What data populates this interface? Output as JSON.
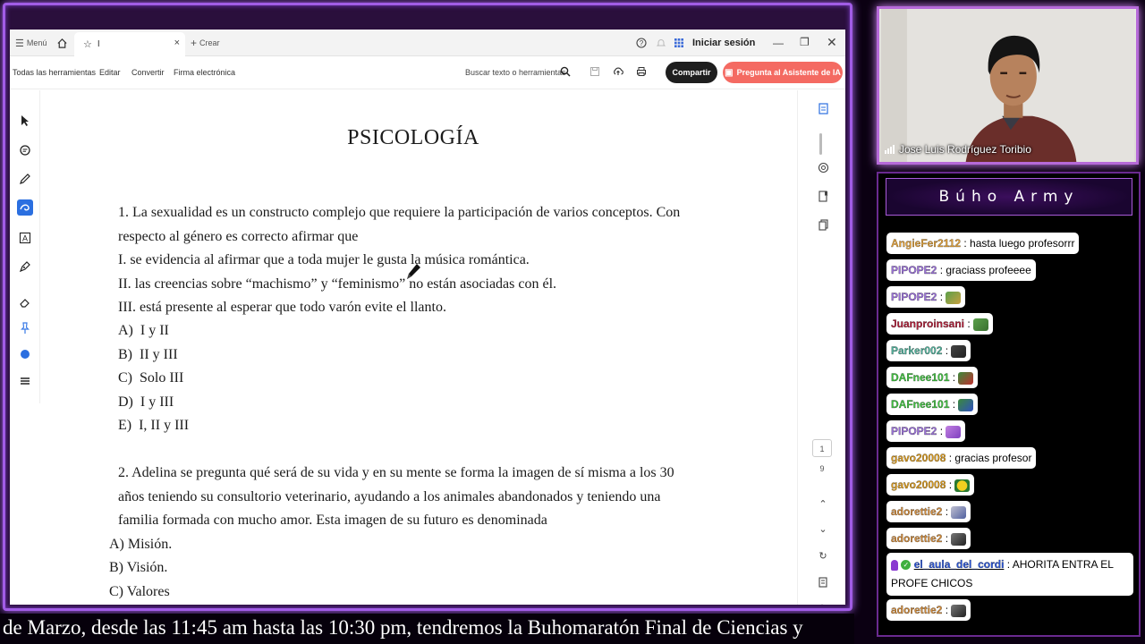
{
  "browser": {
    "menu_label": "Menú",
    "tab_title": "I",
    "new_tab_label": "Crear",
    "sign_in": "Iniciar sesión"
  },
  "toolbar": {
    "all_tools": "Todas las herramientas",
    "edit": "Editar",
    "convert": "Convertir",
    "esign": "Firma electrónica",
    "search_placeholder": "Buscar texto o herramientas",
    "share": "Compartir",
    "ai_assistant": "Pregunta al Asistente de IA"
  },
  "document": {
    "title": "PSICOLOGÍA",
    "q1": {
      "stem_line1": "1. La sexualidad es un constructo complejo que requiere la participación de varios conceptos. Con",
      "stem_line2": "respecto al género es correcto afirmar que",
      "statements": [
        "I. se evidencia al afirmar que a toda mujer le gusta la música romántica.",
        "II. las creencias sobre “machismo” y “feminismo” no están asociadas con él.",
        "III. está presente al esperar que todo varón evite el llanto."
      ],
      "options": [
        "A)  I y II",
        "B)  II y III",
        "C)  Solo III",
        "D)  I y III",
        "E)  I, II y III"
      ]
    },
    "q2": {
      "stem_line1": "2. Adelina se pregunta qué será de su vida y en su mente se forma la imagen de sí misma a los 30",
      "stem_line2": "años teniendo su consultorio veterinario, ayudando a los animales abandonados y teniendo una",
      "stem_line3": "familia formada con mucho amor. Esta imagen de su futuro es denominada",
      "options": [
        "A) Misión.",
        "B) Visión.",
        "C) Valores"
      ]
    }
  },
  "pager": {
    "current": "1",
    "total": "9"
  },
  "ticker_text": "de Marzo, desde las 11:45 am hasta las 10:30 pm, tendremos la Buhomaratón Final de Ciencias y",
  "webcam": {
    "name": "Jose Luis Rodríguez Toribio"
  },
  "chat": {
    "title": "Búho Army",
    "messages": [
      {
        "user": "AngieFer2112",
        "text": ": hasta luego profesorrr",
        "color": "#e0a03a"
      },
      {
        "user": "PIPOPE2",
        "text": ": graciass profeeee",
        "color": "#9a70d8"
      },
      {
        "user": "PIPOPE2",
        "text": ":",
        "color": "#9a70d8"
      },
      {
        "user": "Juanproinsani",
        "text": ":",
        "color": "#b0203a"
      },
      {
        "user": "Parker002",
        "text": ":",
        "color": "#4fb09a"
      },
      {
        "user": "DAFnee101",
        "text": ":",
        "color": "#3fc03f"
      },
      {
        "user": "DAFnee101",
        "text": ":",
        "color": "#3fc03f"
      },
      {
        "user": "PIPOPE2",
        "text": ":",
        "color": "#9a70d8"
      },
      {
        "user": "gavo20008",
        "text": ": gracias profesor",
        "color": "#d89a20"
      },
      {
        "user": "gavo20008",
        "text": ":",
        "color": "#d89a20"
      },
      {
        "user": "adorettie2",
        "text": ":",
        "color": "#d08a3a"
      },
      {
        "user": "adorettie2",
        "text": ":",
        "color": "#d08a3a"
      },
      {
        "user": "el_aula_del_cordi",
        "text": ": AHORITA ENTRA EL PROFE CHICOS",
        "color": "#2a55d8"
      },
      {
        "user": "adorettie2",
        "text": ":",
        "color": "#d08a3a"
      }
    ]
  }
}
